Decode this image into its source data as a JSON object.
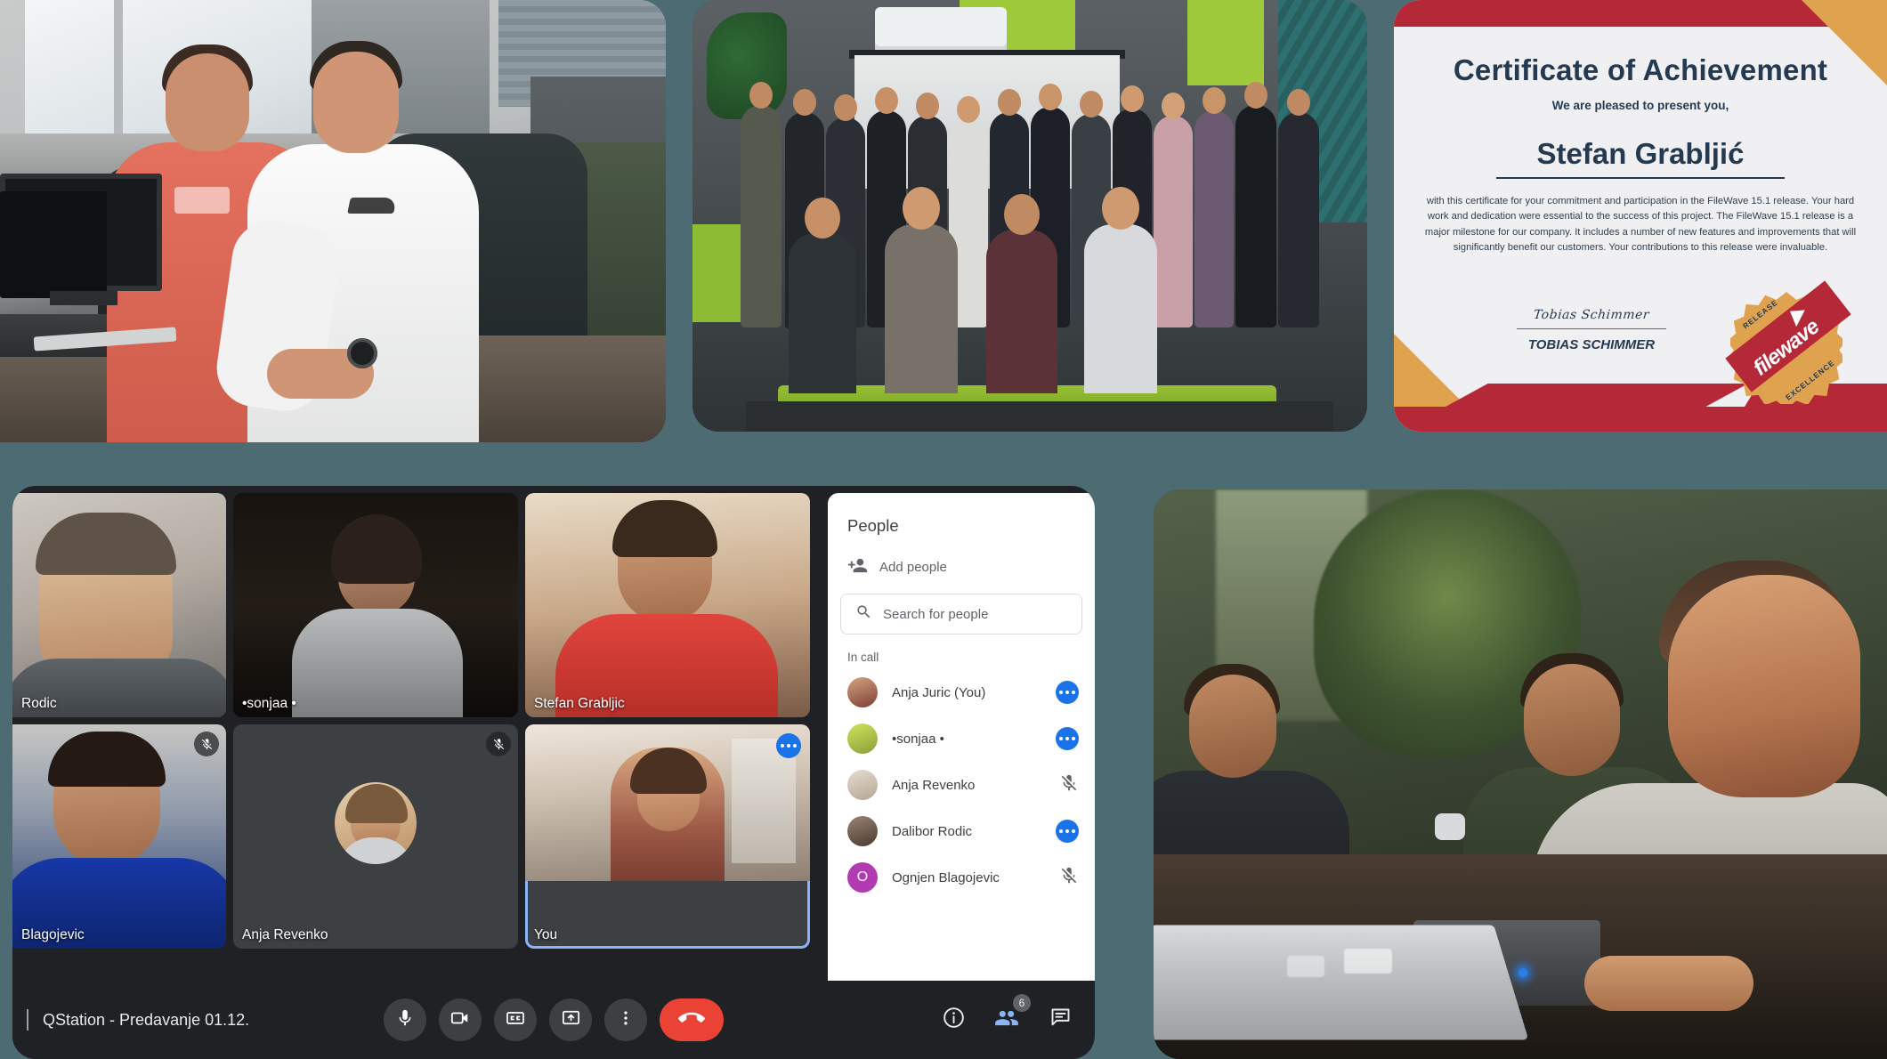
{
  "background_color": "#4d6b73",
  "photos": {
    "devs": {
      "alt": "Two developers working at a desk with a Mac"
    },
    "group": {
      "alt": "Company group photo in an office with a projector screen"
    },
    "students": {
      "alt": "Students working on laptops in a classroom"
    }
  },
  "certificate": {
    "title": "Certificate of Achievement",
    "subtitle": "We are pleased to present you,",
    "recipient": "Stefan Grabljić",
    "body": "with this certificate for your commitment and participation in the FileWave 15.1 release. Your hard work and dedication were essential to the success of this project. The FileWave 15.1 release is a major milestone for our company. It includes a number of new features and improvements that will significantly benefit our customers. Your contributions to this release were invaluable.",
    "signature_script": "Tobias Schimmer",
    "signature_name": "TOBIAS SCHIMMER",
    "badge": {
      "top_text": "RELEASE",
      "bottom_text": "EXCELLENCE",
      "brand": "filewave"
    },
    "colors": {
      "red": "#b42838",
      "gold": "#dfa24f",
      "navy": "#243a52",
      "paper": "#f0f0f2"
    }
  },
  "meet": {
    "meeting_title": "QStation - Predavanje 01.12.",
    "tiles": [
      {
        "name": "Rodic",
        "muted": false,
        "options": false,
        "self": false
      },
      {
        "name": "•sonjaa •",
        "muted": false,
        "options": false,
        "self": false
      },
      {
        "name": "Stefan Grabljic",
        "muted": false,
        "options": false,
        "self": false
      },
      {
        "name": "Blagojevic",
        "muted": true,
        "options": false,
        "self": false
      },
      {
        "name": "Anja Revenko",
        "muted": true,
        "options": false,
        "self": false
      },
      {
        "name": "You",
        "muted": false,
        "options": true,
        "self": true
      }
    ],
    "panel": {
      "title": "People",
      "add_people_label": "Add people",
      "search_placeholder": "Search for people",
      "section_label": "In call",
      "participants": [
        {
          "name": "Anja Juric (You)",
          "action": "options",
          "avatar_type": "photo",
          "avatar_color": "#8c5a4a",
          "initial": ""
        },
        {
          "name": "•sonjaa •",
          "action": "options",
          "avatar_type": "photo",
          "avatar_color": "#b7d44a",
          "initial": ""
        },
        {
          "name": "Anja Revenko",
          "action": "muted",
          "avatar_type": "photo",
          "avatar_color": "#d8cfc2",
          "initial": ""
        },
        {
          "name": "Dalibor Rodic",
          "action": "options",
          "avatar_type": "photo",
          "avatar_color": "#6b5548",
          "initial": ""
        },
        {
          "name": "Ognjen Blagojevic",
          "action": "muted",
          "avatar_type": "initial",
          "avatar_color": "#b23bb2",
          "initial": "O"
        }
      ]
    },
    "controls": [
      {
        "name": "microphone",
        "icon": "mic-icon"
      },
      {
        "name": "camera",
        "icon": "camera-icon"
      },
      {
        "name": "captions",
        "icon": "cc-icon"
      },
      {
        "name": "present",
        "icon": "present-icon"
      },
      {
        "name": "more-options",
        "icon": "more-vertical-icon"
      },
      {
        "name": "leave-call",
        "icon": "hangup-icon"
      }
    ],
    "right_controls": {
      "info_label": "Meeting details",
      "people_badge": "6",
      "chat_label": "Chat"
    },
    "accent_blue": "#1a73e8",
    "hangup_red": "#ea4335"
  }
}
